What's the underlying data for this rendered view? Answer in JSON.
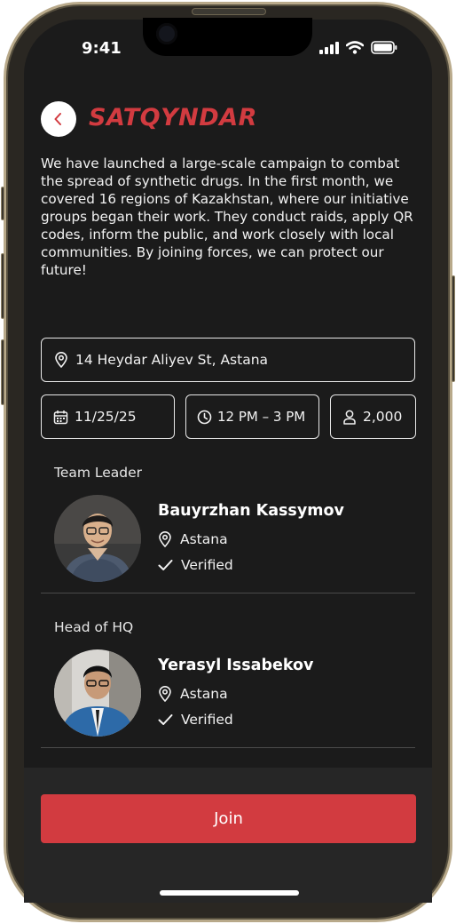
{
  "status_bar": {
    "time": "9:41"
  },
  "header": {
    "title": "SATQYNDAR"
  },
  "description": "We have launched a large-scale campaign to combat the spread of synthetic drugs. In the first month, we covered 16 regions of Kazakhstan, where our initiative groups began their work. They conduct raids, apply QR codes, inform the public, and work closely with local communities. By joining forces, we can protect our future!",
  "event": {
    "address": "14 Heydar Aliyev St, Astana",
    "date": "11/25/25",
    "time": "12 PM – 3 PM",
    "participants": "2,000"
  },
  "people": [
    {
      "role": "Team Leader",
      "name": "Bauyrzhan Kassymov",
      "city": "Astana",
      "status": "Verified"
    },
    {
      "role": "Head of HQ",
      "name": "Yerasyl Issabekov",
      "city": "Astana",
      "status": "Verified"
    }
  ],
  "action": {
    "join_label": "Join"
  },
  "colors": {
    "accent": "#d23b40",
    "background": "#1b1b1b",
    "footer": "#262626"
  }
}
